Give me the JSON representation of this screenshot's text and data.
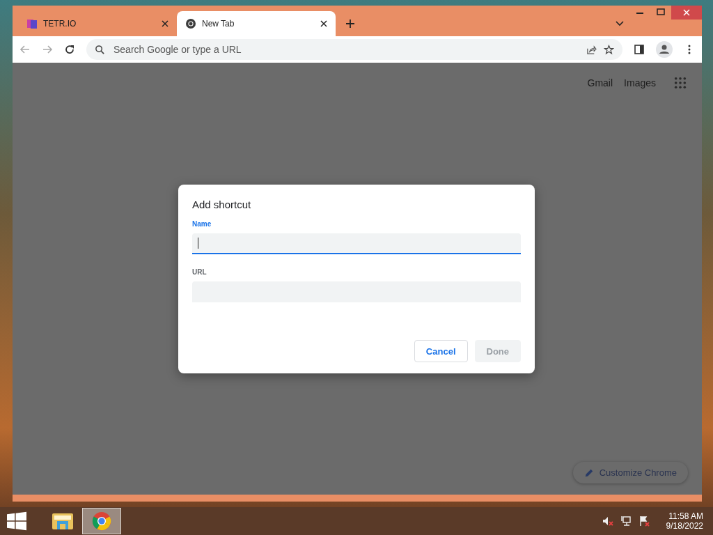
{
  "window": {
    "tabs": [
      {
        "title": "TETR.IO",
        "kind": "tetrio",
        "selected": false
      },
      {
        "title": "New Tab",
        "kind": "chrome",
        "selected": true
      }
    ],
    "address_bar": {
      "placeholder": "Search Google or type a URL"
    }
  },
  "page": {
    "links": [
      "Gmail",
      "Images"
    ],
    "customize_button": "Customize Chrome"
  },
  "dialog": {
    "title": "Add shortcut",
    "fields": [
      {
        "label": "Name",
        "focused": true
      },
      {
        "label": "URL",
        "focused": false
      }
    ],
    "buttons": [
      {
        "label": "Cancel",
        "disabled": false
      },
      {
        "label": "Done",
        "disabled": true
      }
    ]
  },
  "taskbar": {
    "apps": [
      {
        "kind": "explorer",
        "selected": false
      },
      {
        "kind": "chrome",
        "selected": true
      }
    ],
    "time": "11:58 AM",
    "date": "9/18/2022"
  }
}
